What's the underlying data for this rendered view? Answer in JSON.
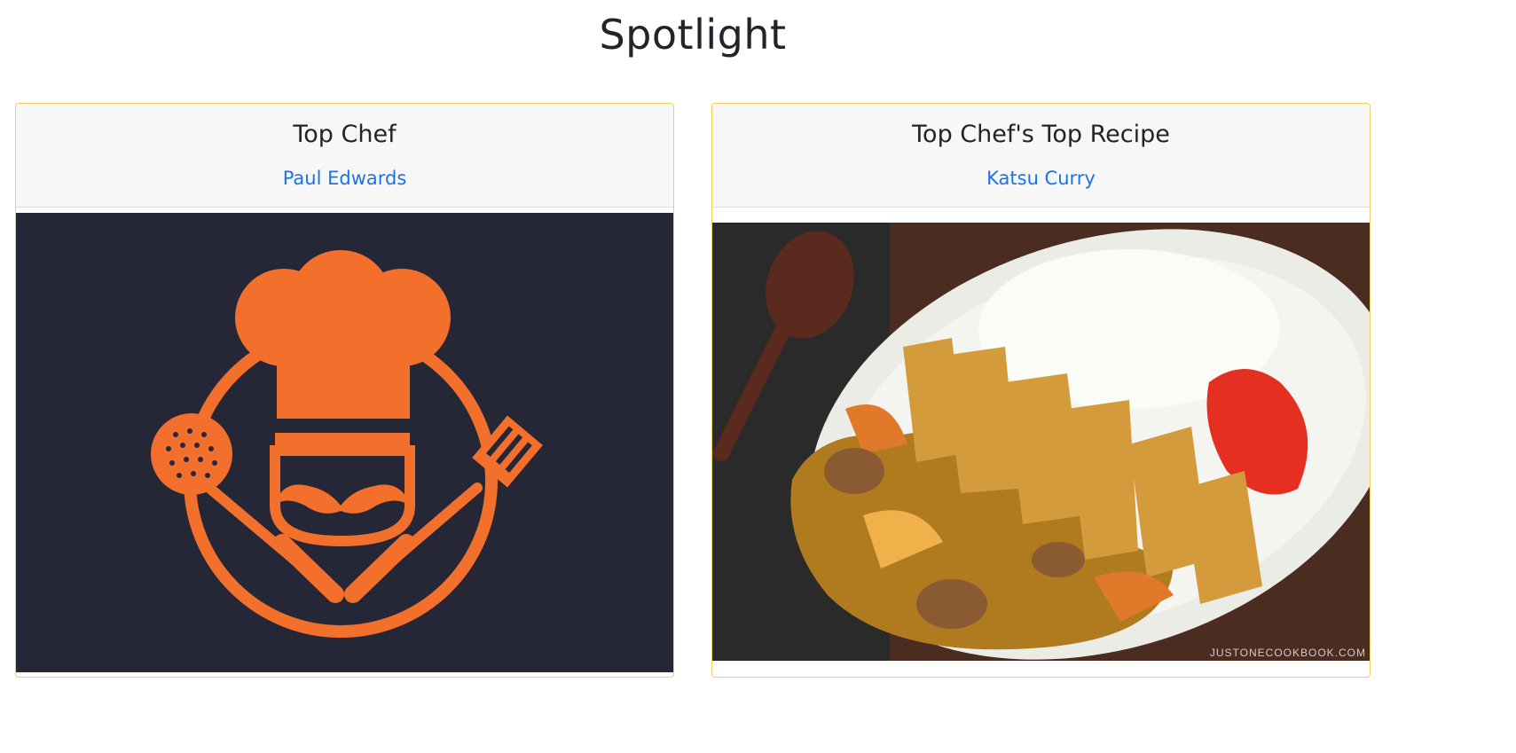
{
  "page": {
    "title": "Spotlight"
  },
  "cards": [
    {
      "title": "Top Chef",
      "link": "Paul Edwards",
      "image_alt": "chef-logo"
    },
    {
      "title": "Top Chef's Top Recipe",
      "link": "Katsu Curry",
      "image_alt": "katsu-curry-photo",
      "watermark": "JUSTONECOOKBOOK.COM"
    }
  ],
  "colors": {
    "card_border": "#f2d15b",
    "link": "#1a73e8",
    "logo_bg": "#252736",
    "logo_fg": "#f26f2c"
  }
}
